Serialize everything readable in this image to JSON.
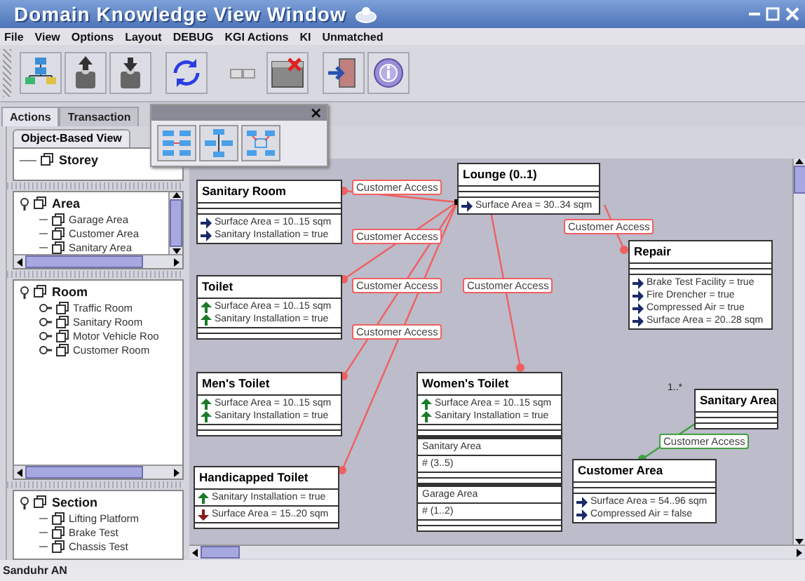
{
  "window": {
    "title": "Domain Knowledge View Window"
  },
  "menu": [
    "File",
    "View",
    "Options",
    "Layout",
    "DEBUG",
    "KGI Actions",
    "KI",
    "Unmatched"
  ],
  "toolbar": [
    {
      "kind": "hierarchy"
    },
    {
      "kind": "upload"
    },
    {
      "kind": "download"
    },
    {
      "kind": "refresh"
    },
    {
      "kind": "toggle"
    },
    {
      "kind": "close-window"
    },
    {
      "kind": "exit"
    },
    {
      "kind": "info"
    }
  ],
  "tabs": [
    {
      "label": "Actions",
      "selected": true
    },
    {
      "label": "Transaction",
      "selected": false
    }
  ],
  "palette": {
    "close": "×",
    "buttons": [
      {
        "kind": "layout-grid"
      },
      {
        "kind": "layout-tree"
      },
      {
        "kind": "layout-frame"
      }
    ]
  },
  "tree_panel": {
    "tab": "Object-Based View",
    "groups": [
      {
        "label": "Storey"
      },
      {
        "label": "Area",
        "expanded": true,
        "children": [
          {
            "label": "Garage Area"
          },
          {
            "label": "Customer Area"
          },
          {
            "label": "Sanitary Area"
          }
        ]
      },
      {
        "label": "Room",
        "expanded": true,
        "children": [
          {
            "label": "Traffic Room",
            "expanded": false
          },
          {
            "label": "Sanitary Room",
            "expanded": false
          },
          {
            "label": "Motor Vehicle Roo",
            "expanded": false
          },
          {
            "label": "Customer Room",
            "expanded": false
          }
        ]
      },
      {
        "label": "Section",
        "expanded": true,
        "children": [
          {
            "label": "Lifting Platform"
          },
          {
            "label": "Brake Test"
          },
          {
            "label": "Chassis Test"
          }
        ]
      }
    ]
  },
  "diagram": {
    "nodes": [
      {
        "title": "Sanitary Room",
        "compartments": [
          {
            "kind": "blank"
          },
          {
            "kind": "blank"
          },
          {
            "kind": "attributes",
            "items": [
              {
                "kind": "right",
                "text": "Surface Area = 10..15 sqm"
              },
              {
                "kind": "right",
                "text": "Sanitary Installation = true"
              }
            ]
          }
        ]
      },
      {
        "title": "Lounge (0..1)",
        "compartments": [
          {
            "kind": "blank"
          },
          {
            "kind": "blank"
          },
          {
            "kind": "attributes",
            "items": [
              {
                "kind": "right",
                "text": "Surface Area = 30..34 sqm"
              }
            ]
          }
        ]
      },
      {
        "title": "Toilet",
        "compartments": [
          {
            "kind": "attributes",
            "items": [
              {
                "kind": "up",
                "text": "Surface Area = 10..15 sqm"
              },
              {
                "kind": "up",
                "text": "Sanitary Installation = true"
              }
            ]
          },
          {
            "kind": "blank"
          },
          {
            "kind": "blank"
          }
        ]
      },
      {
        "title": "Repair",
        "compartments": [
          {
            "kind": "blank"
          },
          {
            "kind": "blank"
          },
          {
            "kind": "attributes",
            "items": [
              {
                "kind": "right",
                "text": "Brake Test Facility = true"
              },
              {
                "kind": "right",
                "text": "Fire Drencher = true"
              },
              {
                "kind": "right",
                "text": "Compressed Air = true"
              },
              {
                "kind": "right",
                "text": "Surface Area = 20..28 sqm"
              }
            ]
          }
        ]
      },
      {
        "title": "Men's Toilet",
        "compartments": [
          {
            "kind": "attributes",
            "items": [
              {
                "kind": "up",
                "text": "Surface Area = 10..15 sqm"
              },
              {
                "kind": "up",
                "text": "Sanitary Installation = true"
              }
            ]
          },
          {
            "kind": "blank"
          },
          {
            "kind": "blank"
          }
        ]
      },
      {
        "title": "Handicapped Toilet",
        "compartments": [
          {
            "kind": "attributes",
            "items": [
              {
                "kind": "up",
                "text": "Sanitary Installation = true"
              }
            ]
          },
          {
            "kind": "attributes",
            "items": [
              {
                "kind": "down",
                "text": "Surface Area = 15..20 sqm"
              }
            ]
          },
          {
            "kind": "blank"
          }
        ]
      },
      {
        "title": "Women's Toilet",
        "compartments": [
          {
            "kind": "attributes",
            "items": [
              {
                "kind": "up",
                "text": "Surface Area = 10..15 sqm"
              },
              {
                "kind": "up",
                "text": "Sanitary Installation = true"
              }
            ]
          },
          {
            "kind": "blank"
          },
          {
            "kind": "blank"
          },
          {
            "kind": "heading",
            "text": "Sanitary Area"
          },
          {
            "kind": "multiplicity",
            "text": "# (3..5)"
          },
          {
            "kind": "blank"
          },
          {
            "kind": "blank"
          },
          {
            "kind": "heading",
            "text": "Garage Area"
          },
          {
            "kind": "multiplicity",
            "text": "# (1..2)"
          },
          {
            "kind": "blank"
          },
          {
            "kind": "blank"
          }
        ]
      },
      {
        "title": "Sanitary Area",
        "compartments": [
          {
            "kind": "blank"
          },
          {
            "kind": "blank"
          },
          {
            "kind": "blank"
          }
        ]
      },
      {
        "title": "Customer Area",
        "compartments": [
          {
            "kind": "blank"
          },
          {
            "kind": "blank"
          },
          {
            "kind": "attributes",
            "items": [
              {
                "kind": "right",
                "text": "Surface Area = 54..96 sqm"
              },
              {
                "kind": "right",
                "text": "Compressed Air = false"
              }
            ]
          }
        ]
      }
    ],
    "edges": [
      {
        "label": "Customer Access",
        "color": "#f06060"
      },
      {
        "label": "Customer Access",
        "color": "#f06060"
      },
      {
        "label": "Customer Access",
        "color": "#f06060"
      },
      {
        "label": "Customer Access",
        "color": "#f06060"
      },
      {
        "label": "Customer Access",
        "color": "#f06060"
      },
      {
        "label": "Customer Access",
        "color": "#f06060"
      },
      {
        "label": "Customer Access",
        "color": "#40a040",
        "multiplicity": "1..*"
      }
    ]
  },
  "status_bar": "Sanduhr AN"
}
